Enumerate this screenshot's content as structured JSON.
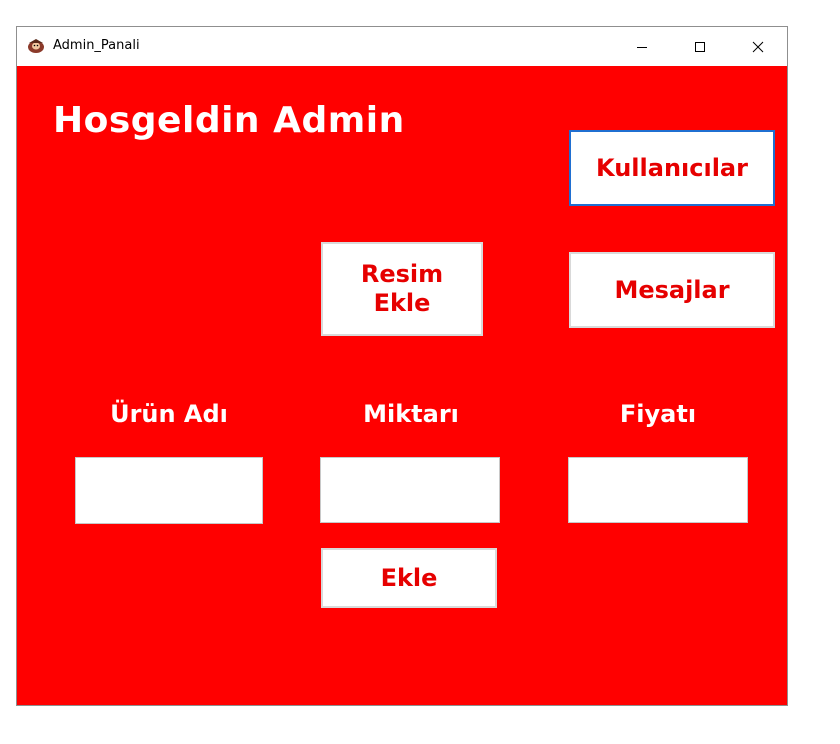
{
  "window": {
    "title": "Admin_Panali",
    "icon": "app-icon"
  },
  "heading": "Hosgeldin Admin",
  "buttons": {
    "kullanicilar": "Kullanıcılar",
    "resim_ekle": "Resim\nEkle",
    "mesajlar": "Mesajlar",
    "ekle": "Ekle"
  },
  "labels": {
    "urun_adi": "Ürün Adı",
    "miktari": "Miktarı",
    "fiyati": "Fiyatı"
  },
  "fields": {
    "urun_adi": "",
    "miktari": "",
    "fiyati": ""
  },
  "colors": {
    "background": "#ff0000",
    "button_text": "#e60000",
    "label_text": "#ffffff",
    "focus_border": "#1f6fd1"
  }
}
